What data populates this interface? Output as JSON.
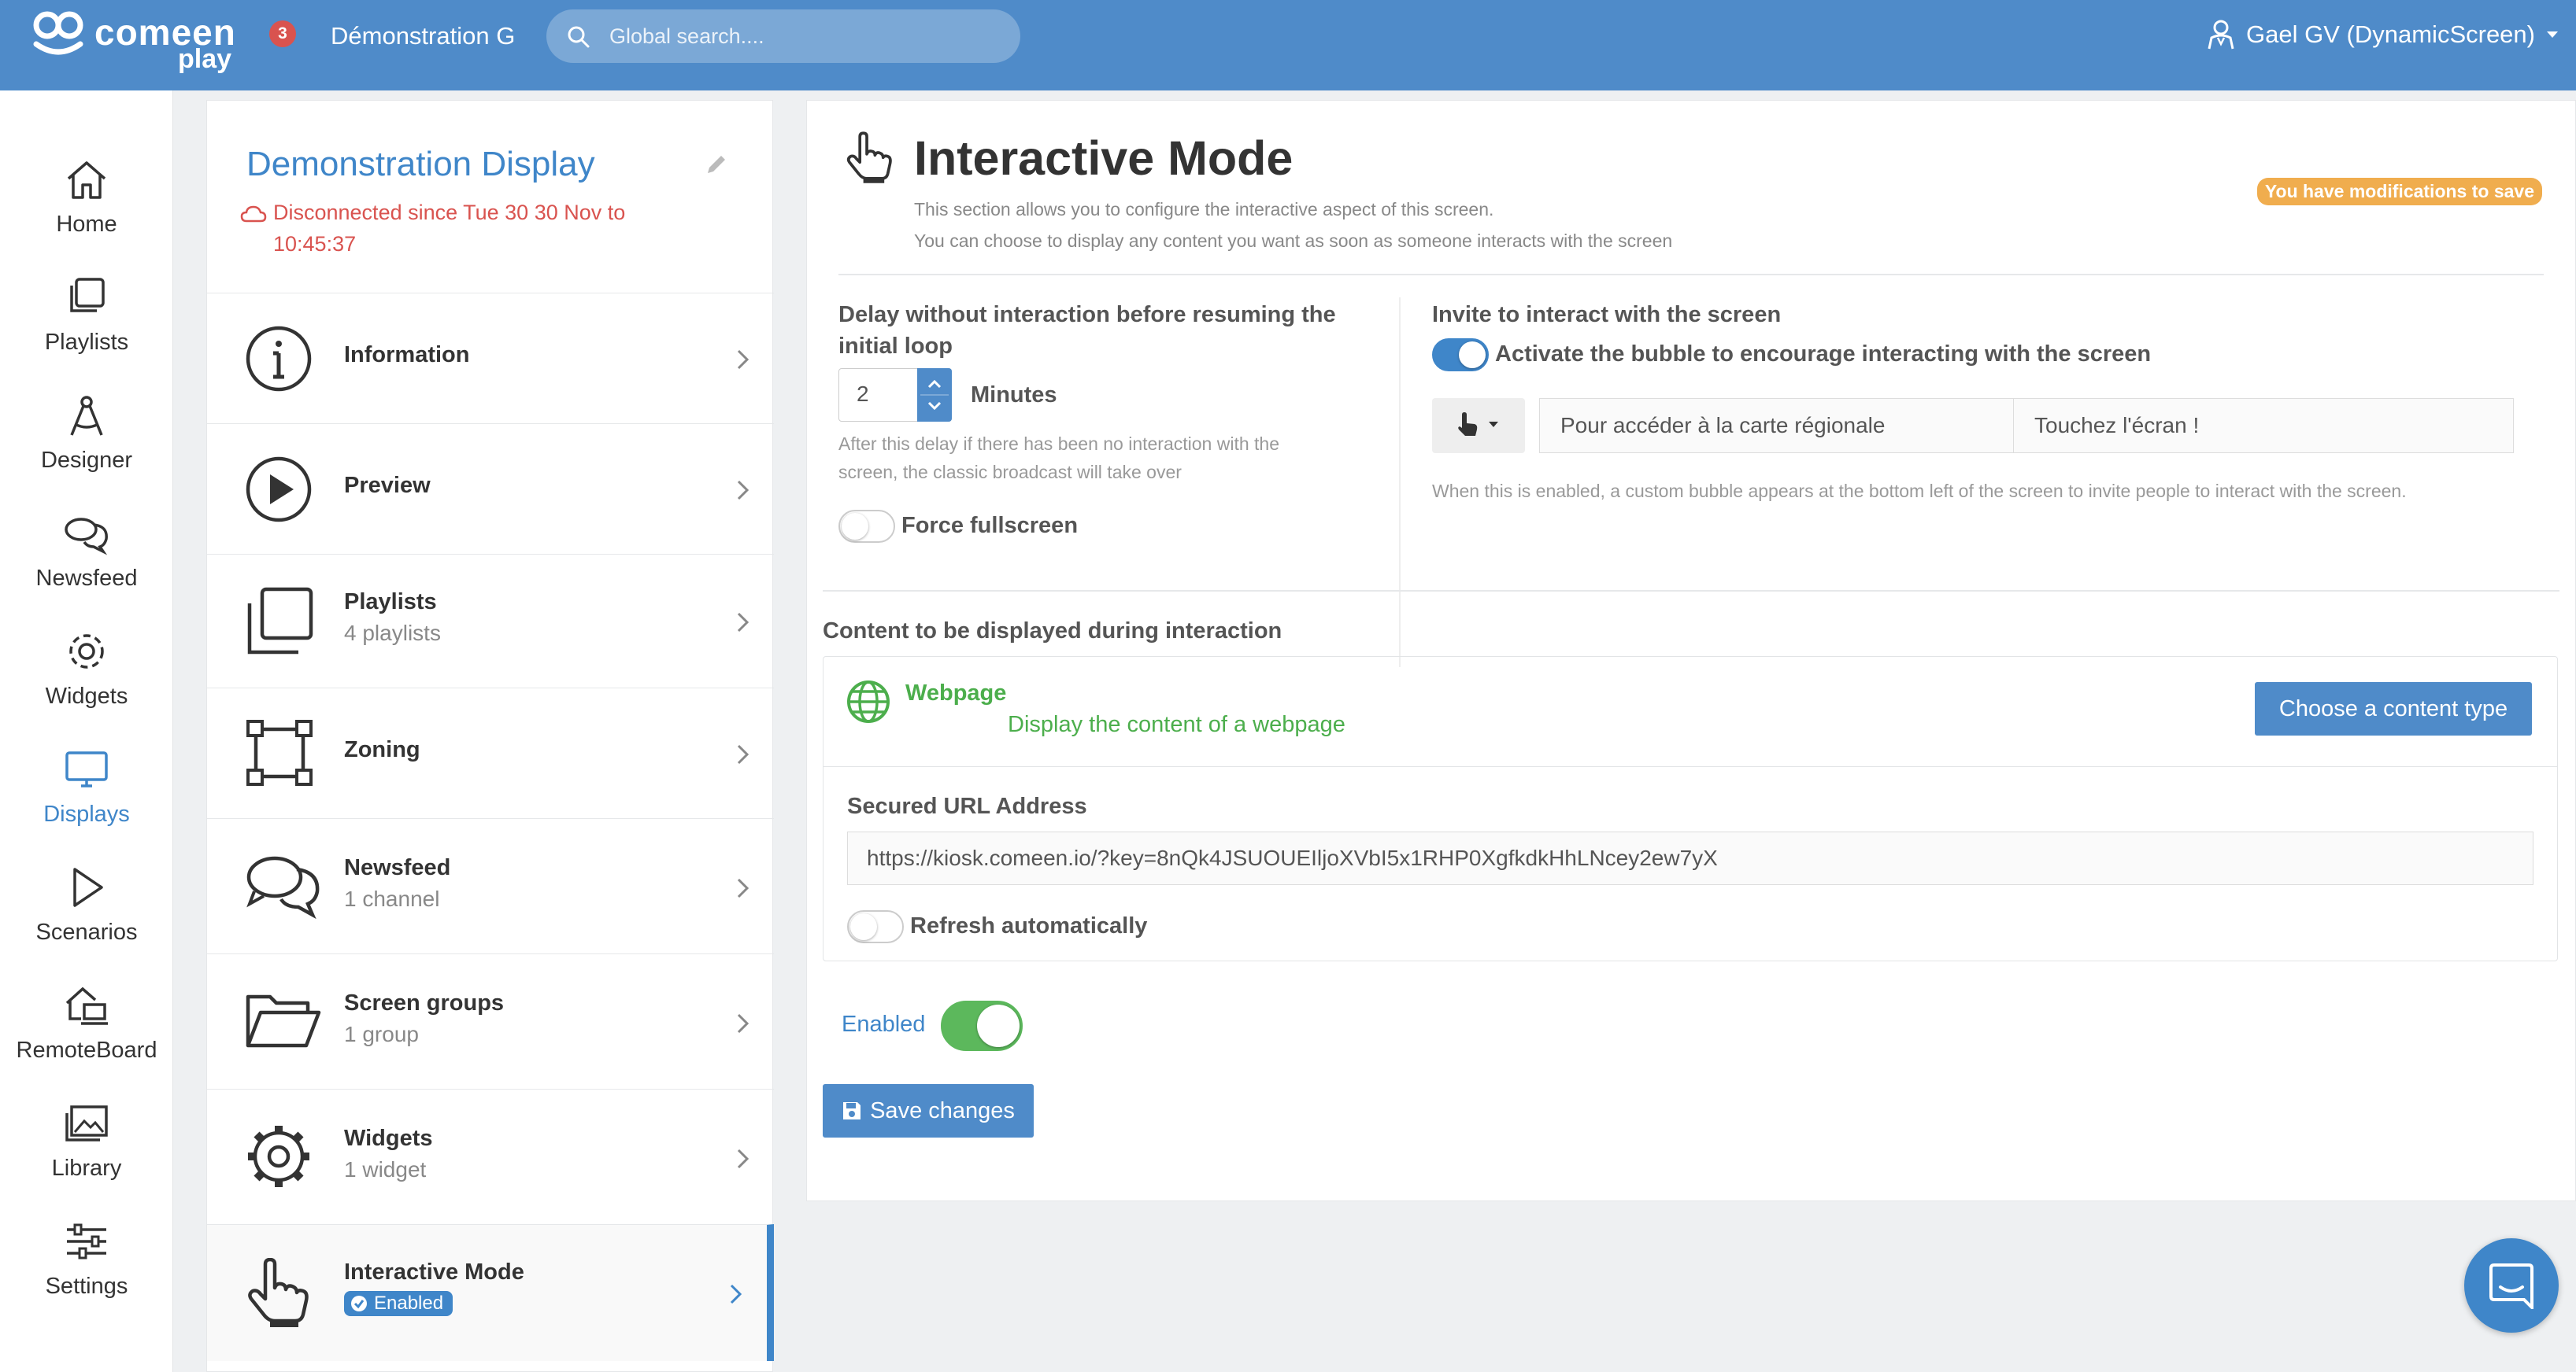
{
  "header": {
    "logo_word": "comeen",
    "logo_sub": "play",
    "notifications_count": "3",
    "workspace": "Démonstration G",
    "search_placeholder": "Global search....",
    "user": "Gael GV (DynamicScreen)"
  },
  "nav": [
    {
      "label": "Home",
      "icon": "home-icon"
    },
    {
      "label": "Playlists",
      "icon": "playlists-icon"
    },
    {
      "label": "Designer",
      "icon": "designer-icon"
    },
    {
      "label": "Newsfeed",
      "icon": "newsfeed-icon"
    },
    {
      "label": "Widgets",
      "icon": "widgets-icon"
    },
    {
      "label": "Displays",
      "icon": "displays-icon",
      "active": true
    },
    {
      "label": "Scenarios",
      "icon": "scenarios-icon"
    },
    {
      "label": "RemoteBoard",
      "icon": "remoteboard-icon"
    },
    {
      "label": "Library",
      "icon": "library-icon"
    },
    {
      "label": "Settings",
      "icon": "settings-icon"
    }
  ],
  "display": {
    "title": "Demonstration Display",
    "status_line1": "Disconnected since Tue 30 30 Nov to",
    "status_line2": "10:45:37"
  },
  "menu": [
    {
      "title": "Information",
      "sub": ""
    },
    {
      "title": "Preview",
      "sub": ""
    },
    {
      "title": "Playlists",
      "sub": "4 playlists"
    },
    {
      "title": "Zoning",
      "sub": ""
    },
    {
      "title": "Newsfeed",
      "sub": "1 channel"
    },
    {
      "title": "Screen groups",
      "sub": "1 group"
    },
    {
      "title": "Widgets",
      "sub": "1 widget"
    },
    {
      "title": "Interactive Mode",
      "badge": "Enabled",
      "active": true
    }
  ],
  "main": {
    "title": "Interactive Mode",
    "desc_line1": "This section allows you to configure the interactive aspect of this screen.",
    "desc_line2": "You can choose to display any content you want as soon as someone interacts with the screen",
    "mod_badge": "You have modifications to save",
    "delay_label_line1": "Delay without interaction before resuming the",
    "delay_label_line2": "initial loop",
    "delay_value": "2",
    "delay_unit": "Minutes",
    "delay_help_line1": "After this delay if there has been no interaction with the",
    "delay_help_line2": "screen, the classic broadcast will take over",
    "force_fullscreen": "Force fullscreen",
    "force_fullscreen_on": false,
    "invite_label": "Invite to interact with the screen",
    "bubble_toggle_label": "Activate the bubble to encourage interacting with the screen",
    "bubble_toggle_on": true,
    "bubble_text1": "Pour accéder à la carte régionale",
    "bubble_text2": "Touchez l'écran !",
    "bubble_help": "When this is enabled, a custom bubble appears at the bottom left of the screen to invite people to interact with the screen.",
    "content_label": "Content to be displayed during interaction",
    "content_type_title": "Webpage",
    "content_type_desc": "Display the content of a webpage",
    "choose_button": "Choose a content type",
    "url_label": "Secured URL Address",
    "url_value": "https://kiosk.comeen.io/?key=8nQk4JSUOUEIljoXVbI5x1RHP0XgfkdkHhLNcey2ew7yX",
    "refresh_label": "Refresh automatically",
    "refresh_on": false,
    "enabled_label": "Enabled",
    "enabled_on": true,
    "save_button": "Save changes"
  },
  "colors": {
    "header": "#4f8bc9",
    "accent": "#3f86c9",
    "error": "#d9534f",
    "warning": "#f0ad4e",
    "success": "#4cae4c",
    "toggle_green": "#5cb85c"
  }
}
